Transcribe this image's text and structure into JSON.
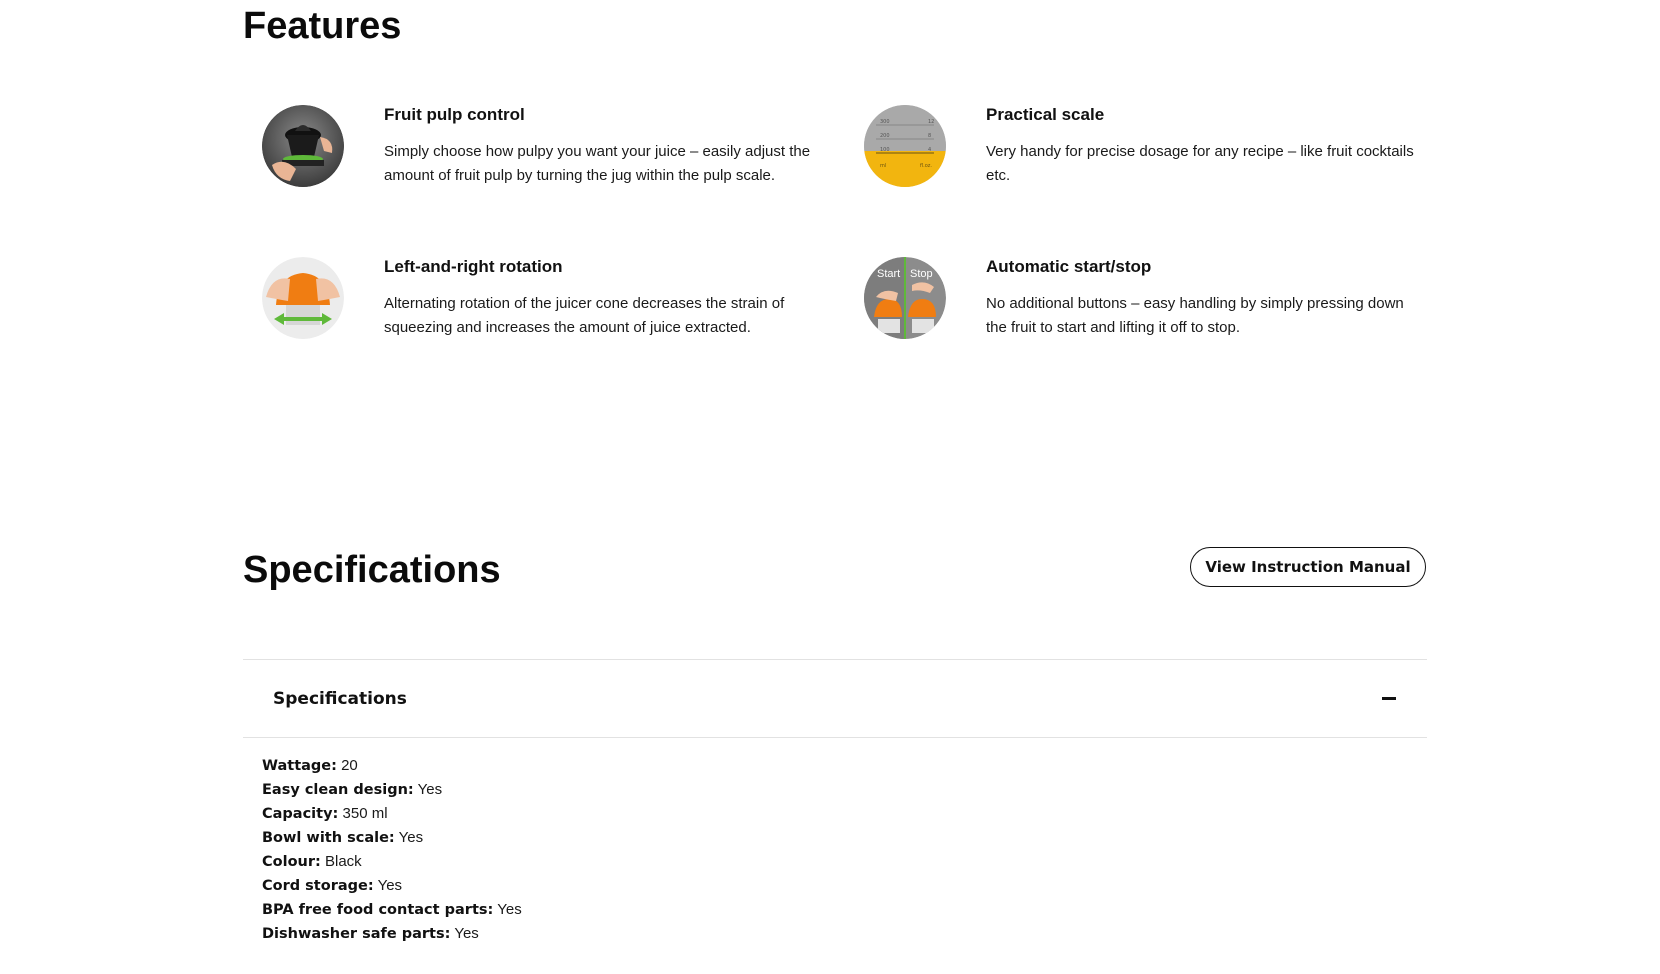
{
  "features": {
    "title": "Features",
    "items": [
      {
        "title": "Fruit pulp control",
        "description": "Simply choose how pulpy you want your juice – easily adjust the amount of fruit pulp by turning the jug within the pulp scale.",
        "icon": "pulp-control-image"
      },
      {
        "title": "Practical scale",
        "description": "Very handy for precise dosage for any recipe – like fruit cocktails etc.",
        "icon": "scale-image"
      },
      {
        "title": "Left-and-right rotation",
        "description": "Alternating rotation of the juicer cone decreases the strain of squeezing and increases the amount of juice extracted.",
        "icon": "rotation-image"
      },
      {
        "title": "Automatic start/stop",
        "description": "No additional buttons – easy handling by simply pressing down the fruit to start and lifting it off to stop.",
        "icon": "start-stop-image",
        "image_labels": [
          "Start",
          "Stop"
        ]
      }
    ],
    "scale_image_text": [
      "300",
      "200",
      "100",
      "ml",
      "fl.oz.",
      "12",
      "8",
      "4"
    ]
  },
  "specifications": {
    "title": "Specifications",
    "manual_button_label": "View Instruction Manual",
    "accordion_title": "Specifications",
    "items": [
      {
        "label": "Wattage:",
        "value": "20"
      },
      {
        "label": "Easy clean design:",
        "value": "Yes"
      },
      {
        "label": "Capacity:",
        "value": "350 ml"
      },
      {
        "label": "Bowl with scale:",
        "value": "Yes"
      },
      {
        "label": "Colour:",
        "value": "Black"
      },
      {
        "label": "Cord storage:",
        "value": "Yes"
      },
      {
        "label": "BPA free food contact parts:",
        "value": "Yes"
      },
      {
        "label": "Dishwasher safe parts:",
        "value": "Yes"
      }
    ]
  },
  "colors": {
    "text": "#111111",
    "divider": "#e2e2e2",
    "orange": "#f07d12",
    "green": "#5fb93a",
    "yellow": "#f2b50f"
  }
}
